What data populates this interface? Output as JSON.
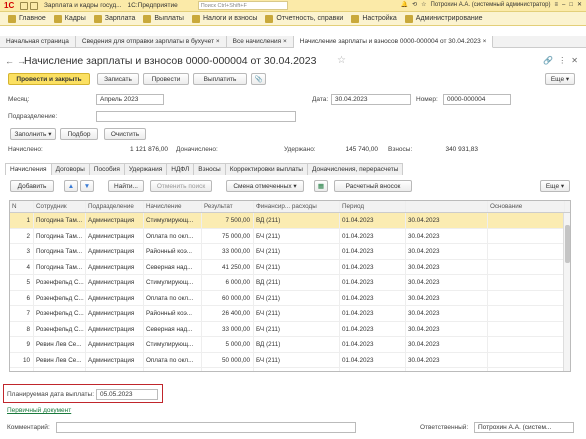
{
  "titlebar": {
    "logo": "1С",
    "title": "Зарплата и кадры госуд...",
    "platform": "1С:Предприятие",
    "search_placeholder": "Поиск Ctrl+Shift+F",
    "user": "Потрохин А.А. (системный администратор)"
  },
  "menu": [
    {
      "label": "Главное",
      "icon": "home-icon"
    },
    {
      "label": "Кадры",
      "icon": "people-icon"
    },
    {
      "label": "Зарплата",
      "icon": "salary-icon"
    },
    {
      "label": "Выплаты",
      "icon": "payment-icon"
    },
    {
      "label": "Налоги и взносы",
      "icon": "percent-icon"
    },
    {
      "label": "Отчетность, справки",
      "icon": "report-icon"
    },
    {
      "label": "Настройка",
      "icon": "gear-icon"
    },
    {
      "label": "Администрирование",
      "icon": "admin-icon"
    }
  ],
  "doc_tabs": [
    {
      "label": "Начальная страница",
      "active": false
    },
    {
      "label": "Сведения для отправки зарплаты в бухучет ×",
      "active": false
    },
    {
      "label": "Все начисления ×",
      "active": false
    },
    {
      "label": "Начисление зарплаты и взносов 0000-000004 от 30.04.2023 ×",
      "active": true
    }
  ],
  "form": {
    "title": "Начисление зарплаты и взносов 0000-000004 от 30.04.2023",
    "buttons": {
      "post_close": "Провести и закрыть",
      "save": "Записать",
      "post": "Провести",
      "payout": "Выплатить",
      "more": "Еще ▾"
    },
    "month_label": "Месяц:",
    "month_value": "Апрель 2023",
    "date_label": "Дата:",
    "date_value": "30.04.2023",
    "number_label": "Номер:",
    "number_value": "0000-000004",
    "dept_label": "Подразделение:",
    "dept_value": "",
    "fill_button": "Заполнить ▾",
    "select_button": "Подбор",
    "clear_button": "Очистить",
    "accrued_label": "Начислено:",
    "accrued_value": "1 121 876,00",
    "extra_label": "Доначислено:",
    "extra_value": "",
    "withheld_label": "Удержано:",
    "withheld_value": "145 740,00",
    "contrib_label": "Взносы:",
    "contrib_value": "340 931,83"
  },
  "subtabs": [
    {
      "label": "Начисления",
      "active": true
    },
    {
      "label": "Договоры",
      "active": false
    },
    {
      "label": "Пособия",
      "active": false
    },
    {
      "label": "Удержания",
      "active": false
    },
    {
      "label": "НДФЛ",
      "active": false
    },
    {
      "label": "Взносы",
      "active": false
    },
    {
      "label": "Корректировки выплаты",
      "active": false
    },
    {
      "label": "Доначисления, перерасчеты",
      "active": false
    }
  ],
  "grid_toolbar": {
    "add": "Добавить",
    "find": "Найти...",
    "cancel_search": "Отменить поиск",
    "change_selected": "Смена отмеченных ▾",
    "calc_details": "Расчетный вносок",
    "more": "Еще ▾"
  },
  "table": {
    "columns": [
      "N",
      "Сотрудник",
      "Подразделение",
      "Начисление",
      "Результат",
      "Финансир... расходы",
      "Период",
      "",
      "Основание"
    ],
    "rows": [
      {
        "n": "1",
        "employee": "Погодина Там...",
        "dept": "Администрация",
        "accrual": "Стимулирующ...",
        "result": "7 500,00",
        "fin": "ВД (211)",
        "from": "01.04.2023",
        "to": "30.04.2023",
        "selected": true
      },
      {
        "n": "2",
        "employee": "Погодина Там...",
        "dept": "Администрация",
        "accrual": "Оплата по окл...",
        "result": "75 000,00",
        "fin": "БЧ (211)",
        "from": "01.04.2023",
        "to": "30.04.2023",
        "selected": false
      },
      {
        "n": "3",
        "employee": "Погодина Там...",
        "dept": "Администрация",
        "accrual": "Районный коэ...",
        "result": "33 000,00",
        "fin": "БЧ (211)",
        "from": "01.04.2023",
        "to": "30.04.2023",
        "selected": false
      },
      {
        "n": "4",
        "employee": "Погодина Там...",
        "dept": "Администрация",
        "accrual": "Северная над...",
        "result": "41 250,00",
        "fin": "БЧ (211)",
        "from": "01.04.2023",
        "to": "30.04.2023",
        "selected": false
      },
      {
        "n": "5",
        "employee": "Розенфельд С...",
        "dept": "Администрация",
        "accrual": "Стимулирующ...",
        "result": "6 000,00",
        "fin": "ВД (211)",
        "from": "01.04.2023",
        "to": "30.04.2023",
        "selected": false
      },
      {
        "n": "6",
        "employee": "Розенфельд С...",
        "dept": "Администрация",
        "accrual": "Оплата по окл...",
        "result": "60 000,00",
        "fin": "БЧ (211)",
        "from": "01.04.2023",
        "to": "30.04.2023",
        "selected": false
      },
      {
        "n": "7",
        "employee": "Розенфельд С...",
        "dept": "Администрация",
        "accrual": "Районный коэ...",
        "result": "26 400,00",
        "fin": "БЧ (211)",
        "from": "01.04.2023",
        "to": "30.04.2023",
        "selected": false
      },
      {
        "n": "8",
        "employee": "Розенфельд С...",
        "dept": "Администрация",
        "accrual": "Северная над...",
        "result": "33 000,00",
        "fin": "БЧ (211)",
        "from": "01.04.2023",
        "to": "30.04.2023",
        "selected": false
      },
      {
        "n": "9",
        "employee": "Ревин Лев Се...",
        "dept": "Администрация",
        "accrual": "Стимулирующ...",
        "result": "5 000,00",
        "fin": "ВД (211)",
        "from": "01.04.2023",
        "to": "30.04.2023",
        "selected": false
      },
      {
        "n": "10",
        "employee": "Ревин Лев Се...",
        "dept": "Администрация",
        "accrual": "Оплата по окл...",
        "result": "50 000,00",
        "fin": "БЧ (211)",
        "from": "01.04.2023",
        "to": "30.04.2023",
        "selected": false
      },
      {
        "n": "11",
        "employee": "Ревин Лев Се...",
        "dept": "Администрация",
        "accrual": "Районный коэ...",
        "result": "22 000,00",
        "fin": "БЧ (211)",
        "from": "01.04.2023",
        "to": "30.04.2023",
        "selected": false
      }
    ]
  },
  "footer": {
    "pay_date_label": "Планируемая дата выплаты:",
    "pay_date_value": "05.05.2023",
    "link": "Первичный документ",
    "comment_label": "Комментарий:",
    "responsible_label": "Ответственный:",
    "responsible_value": "Потрохин А.А. (систем..."
  },
  "colors": {
    "titlebar": "#fbeaa8",
    "primary_button": "#fbe062",
    "selected_row": "#fbecb2",
    "highlight": "#c0262c",
    "link": "#1a7a3c"
  }
}
